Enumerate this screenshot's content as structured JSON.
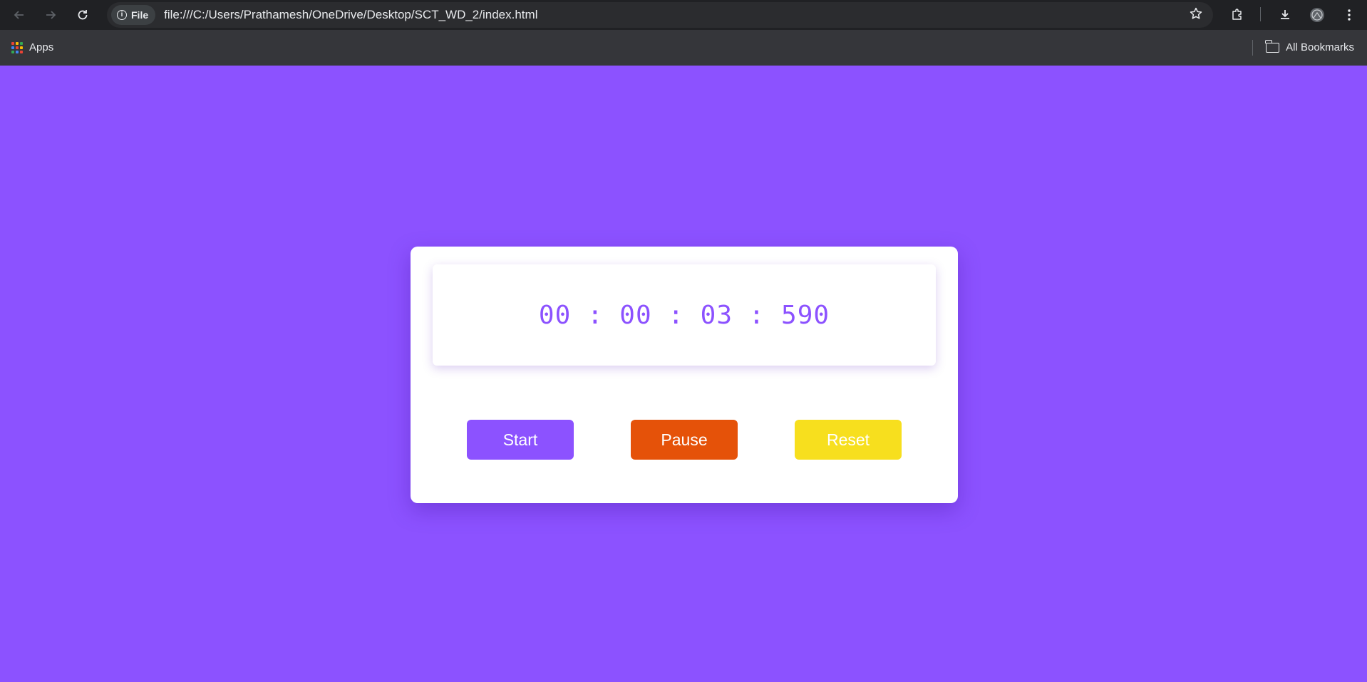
{
  "browser": {
    "site_chip": "File",
    "url": "file:///C:/Users/Prathamesh/OneDrive/Desktop/SCT_WD_2/index.html",
    "bookmarks": {
      "apps_label": "Apps",
      "all_bookmarks_label": "All Bookmarks"
    },
    "icons": [
      "back-arrow-icon",
      "forward-arrow-icon",
      "reload-icon",
      "info-icon",
      "star-icon",
      "extensions-icon",
      "download-icon",
      "profile-icon",
      "menu-dots-icon",
      "apps-grid-icon",
      "folder-icon"
    ]
  },
  "stopwatch": {
    "time": "00 : 00 : 03 : 590",
    "buttons": {
      "start": "Start",
      "pause": "Pause",
      "reset": "Reset"
    },
    "colors": {
      "background": "#8c52ff",
      "start": "#8c52ff",
      "pause": "#e55209",
      "reset": "#f7df1e",
      "time_text": "#8c52ff"
    }
  }
}
